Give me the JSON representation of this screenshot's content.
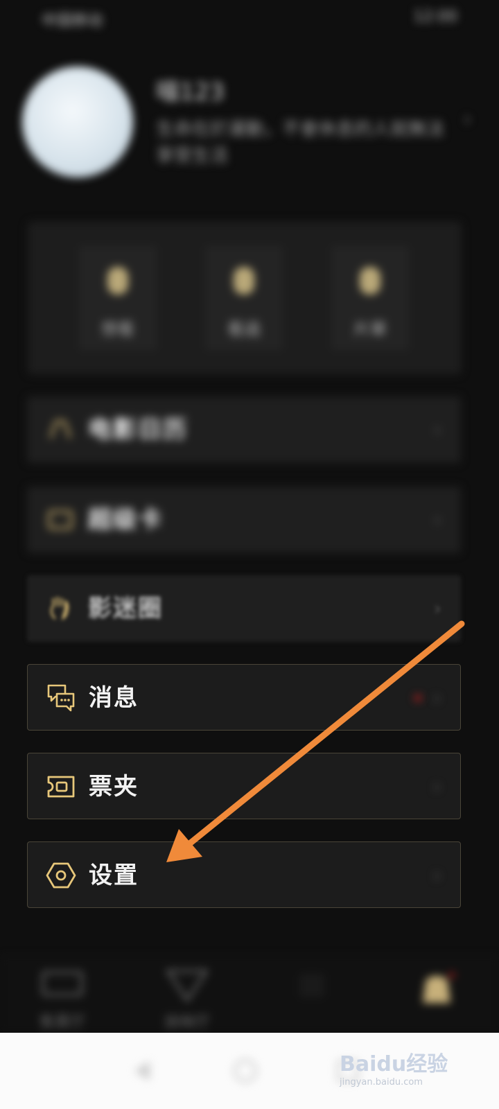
{
  "status_bar": {
    "left": "中国移动",
    "right": "12:00"
  },
  "profile": {
    "username": "喵123",
    "bio": "生命在於運動，不會休息的人就無法享受生活",
    "chevron": "›"
  },
  "stats": [
    {
      "label": "想看"
    },
    {
      "label": "看過"
    },
    {
      "label": "片單"
    }
  ],
  "menu": {
    "blurred": [
      {
        "label": "电影日历"
      },
      {
        "label": "超级卡"
      },
      {
        "label": "影迷圈"
      }
    ],
    "visible": [
      {
        "label": "消息",
        "has_badge": true
      },
      {
        "label": "票夹"
      },
      {
        "label": "设置"
      }
    ],
    "chevron": "›"
  },
  "tabbar": {
    "tabs": [
      {
        "label": "售票厅"
      },
      {
        "label": "放映厅"
      },
      {
        "label": ""
      },
      {
        "label": ""
      }
    ]
  },
  "watermark": {
    "main": "Baidu经验",
    "sub": "jingyan.baidu.com"
  },
  "colors": {
    "background": "#0f0f0f",
    "accent_gold": "#e7c77a",
    "arrow": "#f08a3a",
    "badge": "#b31d1d"
  }
}
